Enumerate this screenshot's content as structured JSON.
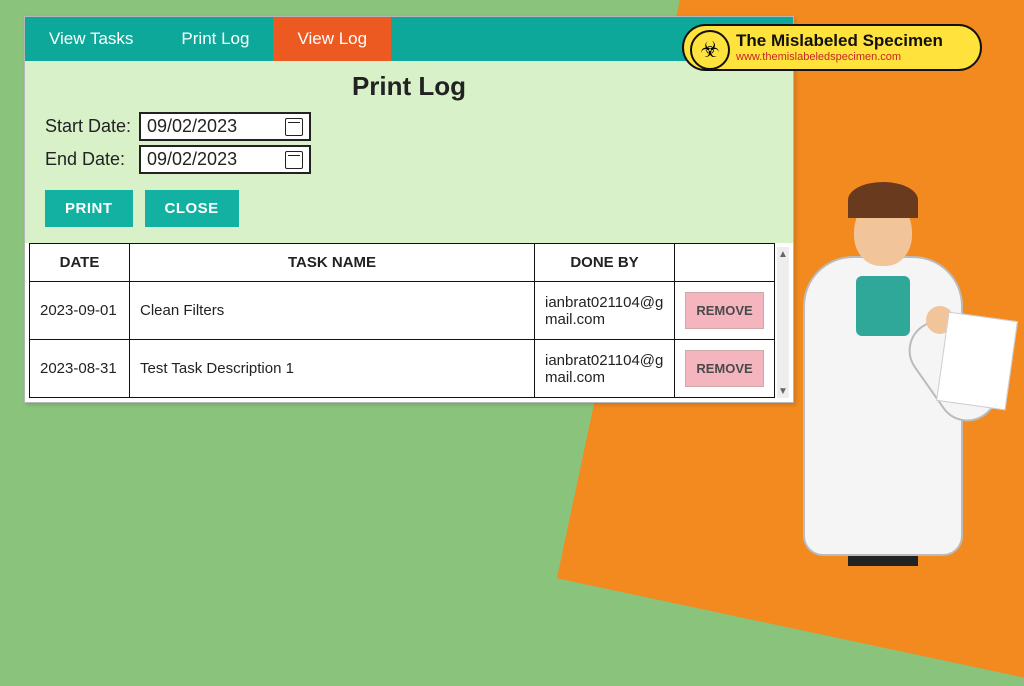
{
  "brand": {
    "title": "The Mislabeled Specimen",
    "url": "www.themislabeledspecimen.com",
    "hazard_glyph": "☣"
  },
  "tabs": [
    {
      "label": "View Tasks",
      "active": false
    },
    {
      "label": "Print Log",
      "active": false
    },
    {
      "label": "View Log",
      "active": true
    }
  ],
  "page": {
    "title": "Print Log",
    "start_label": "Start Date:",
    "end_label": "End Date:",
    "start_value": "09/02/2023",
    "end_value": "09/02/2023",
    "print_btn": "PRINT",
    "close_btn": "CLOSE"
  },
  "table": {
    "headers": {
      "date": "DATE",
      "task": "TASK NAME",
      "done": "DONE BY",
      "action": ""
    },
    "remove_label": "REMOVE",
    "rows": [
      {
        "date": "2023-09-01",
        "task": "Clean Filters",
        "done": "ianbrat021104@gmail.com"
      },
      {
        "date": "2023-08-31",
        "task": "Test Task Description 1",
        "done": "ianbrat021104@gmail.com"
      }
    ]
  }
}
